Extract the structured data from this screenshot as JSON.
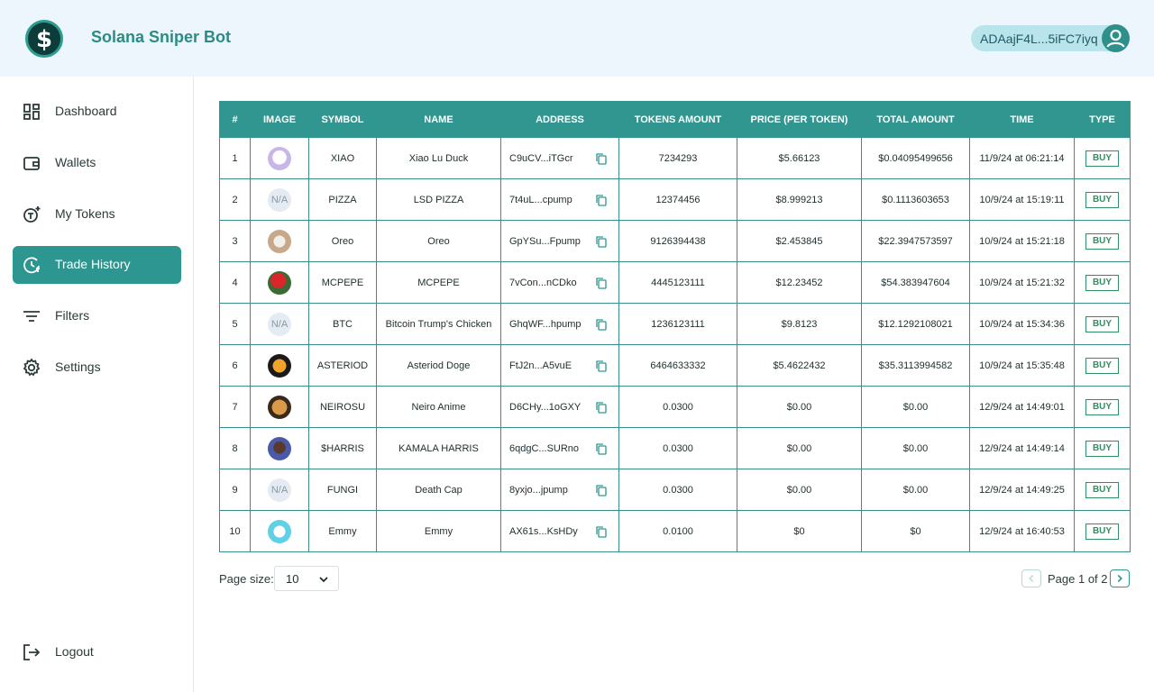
{
  "app": {
    "title": "Solana Sniper Bot"
  },
  "wallet": {
    "address": "ADAajF4L...5iFC7iyq"
  },
  "sidebar": {
    "items": [
      {
        "label": "Dashboard",
        "icon": "dashboard-icon",
        "active": false
      },
      {
        "label": "Wallets",
        "icon": "wallet-icon",
        "active": false
      },
      {
        "label": "My Tokens",
        "icon": "tokens-icon",
        "active": false
      },
      {
        "label": "Trade History",
        "icon": "history-icon",
        "active": true
      },
      {
        "label": "Filters",
        "icon": "filter-icon",
        "active": false
      },
      {
        "label": "Settings",
        "icon": "gear-icon",
        "active": false
      }
    ],
    "logout": "Logout"
  },
  "table": {
    "headers": [
      "#",
      "IMAGE",
      "SYMBOL",
      "NAME",
      "ADDRESS",
      "TOKENS AMOUNT",
      "PRICE (PER TOKEN)",
      "TOTAL AMOUNT",
      "TIME",
      "TYPE"
    ],
    "rows": [
      {
        "n": "1",
        "image": "img",
        "symbol": "XIAO",
        "name": "Xiao Lu Duck",
        "address": "C9uCV...iTGcr",
        "amount": "7234293",
        "price": "$5.66123",
        "total": "$0.04095499656",
        "time": "11/9/24 at 06:21:14",
        "type": "BUY"
      },
      {
        "n": "2",
        "image": "N/A",
        "symbol": "PIZZA",
        "name": "LSD PIZZA",
        "address": "7t4uL...cpump",
        "amount": "12374456",
        "price": "$8.999213",
        "total": "$0.1113603653",
        "time": "10/9/24 at 15:19:11",
        "type": "BUY"
      },
      {
        "n": "3",
        "image": "img",
        "symbol": "Oreo",
        "name": "Oreo",
        "address": "GpYSu...Fpump",
        "amount": "9126394438",
        "price": "$2.453845",
        "total": "$22.3947573597",
        "time": "10/9/24 at 15:21:18",
        "type": "BUY"
      },
      {
        "n": "4",
        "image": "img",
        "symbol": "MCPEPE",
        "name": "MCPEPE",
        "address": "7vCon...nCDko",
        "amount": "4445123111",
        "price": "$12.23452",
        "total": "$54.383947604",
        "time": "10/9/24 at 15:21:32",
        "type": "BUY"
      },
      {
        "n": "5",
        "image": "N/A",
        "symbol": "BTC",
        "name": "Bitcoin Trump's Chicken",
        "address": "GhqWF...hpump",
        "amount": "1236123111",
        "price": "$9.8123",
        "total": "$12.1292108021",
        "time": "10/9/24 at 15:34:36",
        "type": "BUY"
      },
      {
        "n": "6",
        "image": "img",
        "symbol": "ASTERIOD",
        "name": "Asteriod Doge",
        "address": "FtJ2n...A5vuE",
        "amount": "6464633332",
        "price": "$5.4622432",
        "total": "$35.3113994582",
        "time": "10/9/24 at 15:35:48",
        "type": "BUY"
      },
      {
        "n": "7",
        "image": "img",
        "symbol": "NEIROSU",
        "name": "Neiro Anime",
        "address": "D6CHy...1oGXY",
        "amount": "0.0300",
        "price": "$0.00",
        "total": "$0.00",
        "time": "12/9/24 at 14:49:01",
        "type": "BUY"
      },
      {
        "n": "8",
        "image": "img",
        "symbol": "$HARRIS",
        "name": "KAMALA HARRIS",
        "address": "6qdgC...SURno",
        "amount": "0.0300",
        "price": "$0.00",
        "total": "$0.00",
        "time": "12/9/24 at 14:49:14",
        "type": "BUY"
      },
      {
        "n": "9",
        "image": "N/A",
        "symbol": "FUNGI",
        "name": "Death Cap",
        "address": "8yxjo...jpump",
        "amount": "0.0300",
        "price": "$0.00",
        "total": "$0.00",
        "time": "12/9/24 at 14:49:25",
        "type": "BUY"
      },
      {
        "n": "10",
        "image": "img",
        "symbol": "Emmy",
        "name": "Emmy",
        "address": "AX61s...KsHDy",
        "amount": "0.0100",
        "price": "$0",
        "total": "$0",
        "time": "12/9/24 at 16:40:53",
        "type": "BUY"
      }
    ]
  },
  "footer": {
    "page_size_label": "Page size:",
    "page_size_value": "10",
    "page_text": "Page 1 of 2"
  },
  "colors": {
    "accent": "#319590",
    "header_bg": "#eef6fd",
    "buy": "#2f8f61"
  }
}
